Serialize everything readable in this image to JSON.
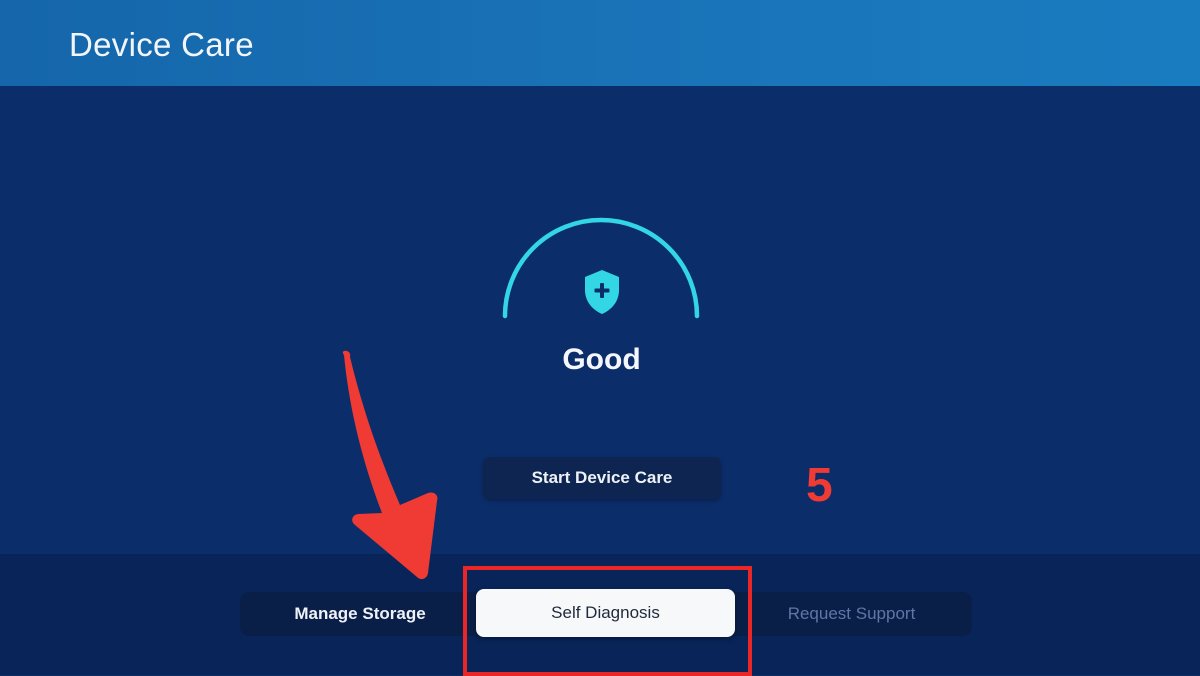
{
  "header": {
    "title": "Device Care"
  },
  "status": {
    "label": "Good",
    "icon": "shield-plus-icon",
    "accent_color": "#33d6e4"
  },
  "actions": {
    "start_label": "Start Device Care"
  },
  "annotation": {
    "step_number": "5",
    "color": "#ea2627"
  },
  "tabs": [
    {
      "label": "Manage Storage",
      "state": "default"
    },
    {
      "label": "Self Diagnosis",
      "state": "focused"
    },
    {
      "label": "Request Support",
      "state": "disabled"
    }
  ]
}
